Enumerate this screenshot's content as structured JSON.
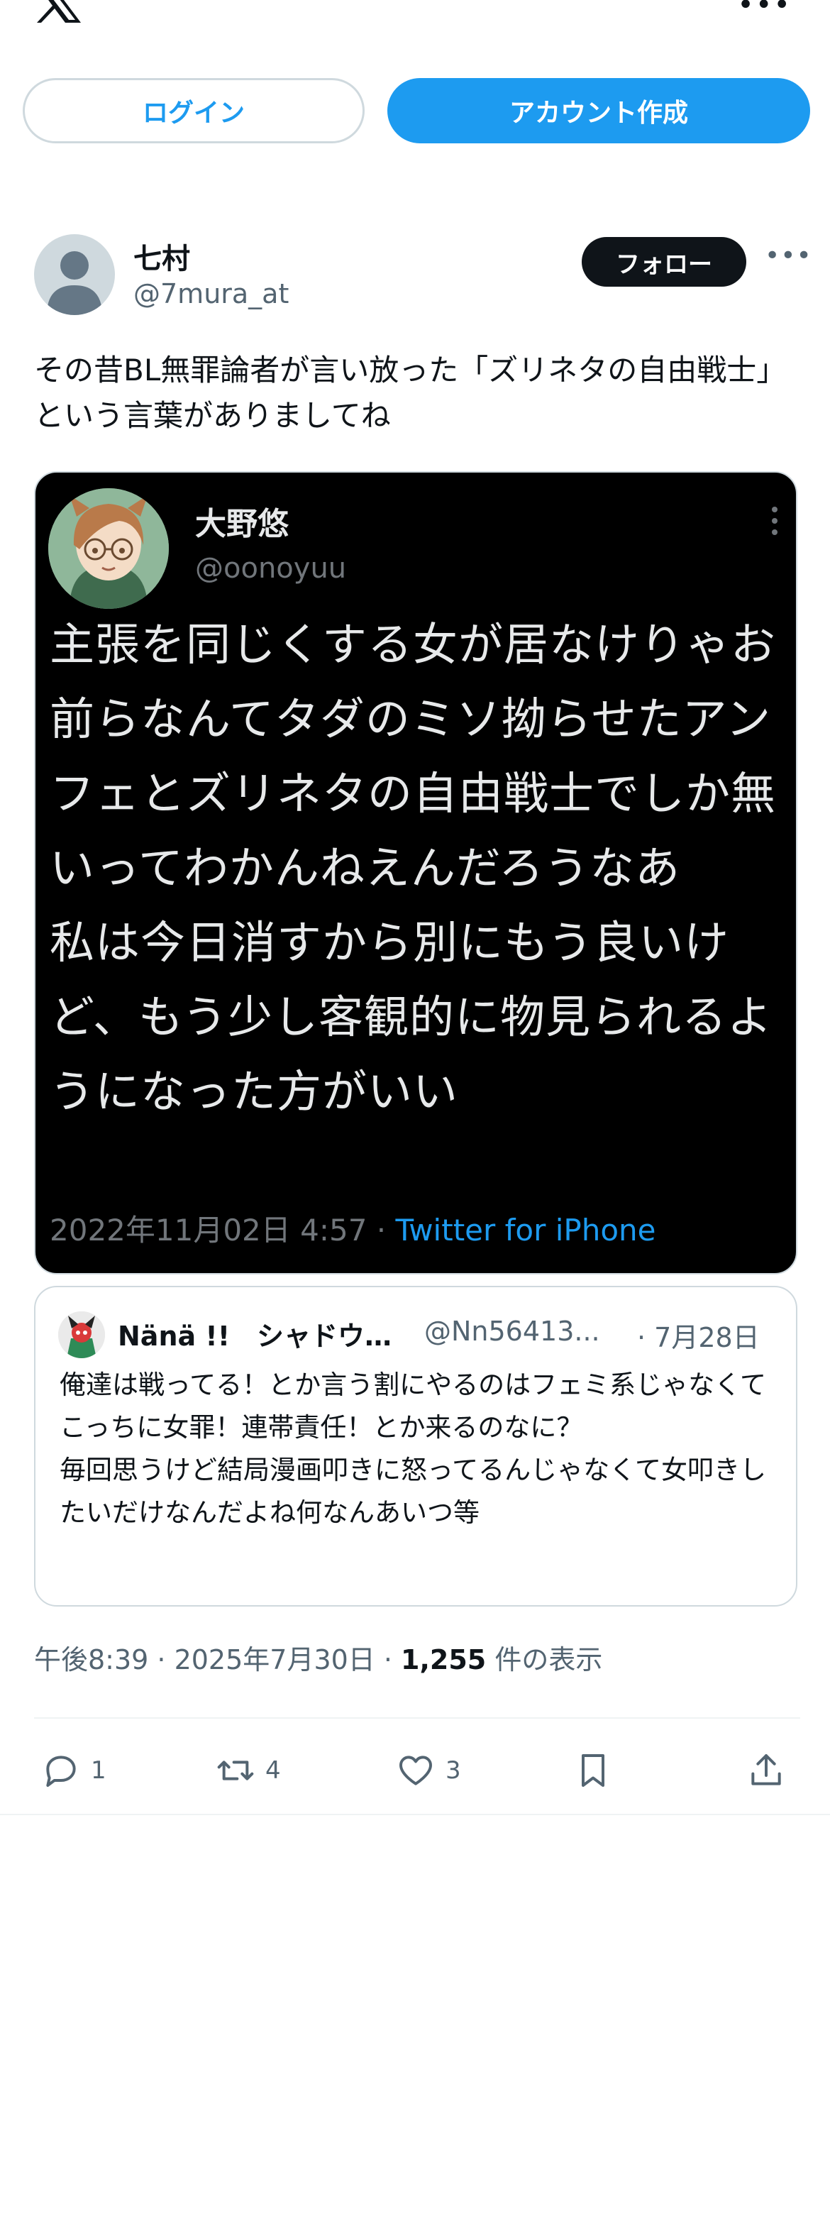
{
  "header": {
    "logo": "x-logo-icon",
    "login_label": "ログイン",
    "signup_label": "アカウント作成"
  },
  "post": {
    "display_name": "七村",
    "handle": "@7mura_at",
    "follow_label": "フォロー",
    "text": "その昔BL無罪論者が言い放った「ズリネタの自由戦士」という言葉がありましてね",
    "timestamp": "午後8:39 · 2025年7月30日 · ",
    "views_count": "1,255",
    "views_label": " 件の表示",
    "actions": {
      "reply_count": "1",
      "retweet_count": "4",
      "like_count": "3"
    }
  },
  "media": {
    "name": "大野悠",
    "handle": "@oonoyuu",
    "text": "主張を同じくする女が居なけりゃお前らなんてタダのミソ拗らせたアンフェとズリネタの自由戦士でしか無いってわかんねえんだろうなあ\n私は今日消すから別にもう良いけど、もう少し客観的に物見られるようになった方がいい",
    "date": "2022年11月02日 4:57 · ",
    "source": "Twitter for iPhone"
  },
  "quote": {
    "name": "Nänä !!　シャドウバン中",
    "handle": "@Nn56413...",
    "date": "· 7月28日",
    "text": "俺達は戦ってる！とか言う割にやるのはフェミ系じゃなくてこっちに女罪！連帯責任！とか来るのなに？\n毎回思うけど結局漫画叩きに怒ってるんじゃなくて女叩きしたいだけなんだよね何なんあいつ等"
  },
  "colors": {
    "accent": "#1d9bf0",
    "text_primary": "#0f1419",
    "text_secondary": "#536471",
    "border": "#cfd9de"
  }
}
